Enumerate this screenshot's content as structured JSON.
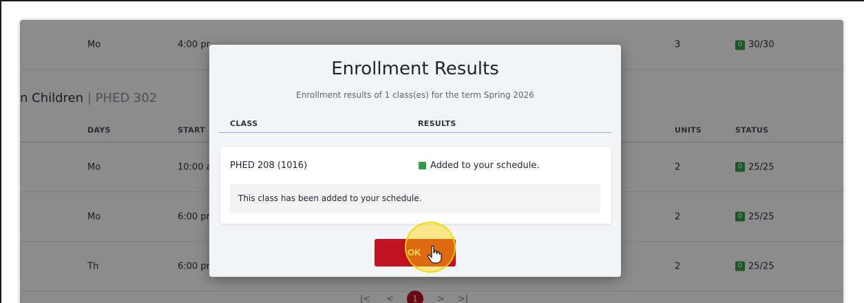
{
  "table": {
    "top_row": {
      "days": "Mo",
      "start": "4:00 pr",
      "units": "3",
      "seat_badge": "0",
      "seats": "30/30"
    },
    "section": {
      "title": "n Children",
      "separator": "|",
      "code": "PHED 302"
    },
    "headers": {
      "days": "DAYS",
      "start": "START",
      "units": "UNITS",
      "status": "STATUS"
    },
    "rows": [
      {
        "days": "Mo",
        "start": "10:00 a",
        "units": "2",
        "seat_badge": "0",
        "seats": "25/25"
      },
      {
        "days": "Mo",
        "start": "6:00 pr",
        "units": "2",
        "seat_badge": "0",
        "seats": "25/25"
      },
      {
        "days": "Th",
        "start": "6:00 pr",
        "units": "2",
        "seat_badge": "0",
        "seats": "25/25"
      }
    ],
    "pagination": {
      "first": "|<",
      "prev": "<",
      "current": "1",
      "next": ">",
      "last": ">|"
    }
  },
  "modal": {
    "title": "Enrollment Results",
    "subtitle": "Enrollment results of 1 class(es) for the term Spring 2026",
    "col_class": "CLASS",
    "col_results": "RESULTS",
    "result": {
      "class": "PHED 208 (1016)",
      "status": "Added to your schedule.",
      "status_color": "#2f9e44",
      "note": "This class has been added to your schedule."
    },
    "ok_label": "OK",
    "ok_color": "#c1121f"
  },
  "cursor": {
    "icon": "hand-pointer-icon"
  }
}
